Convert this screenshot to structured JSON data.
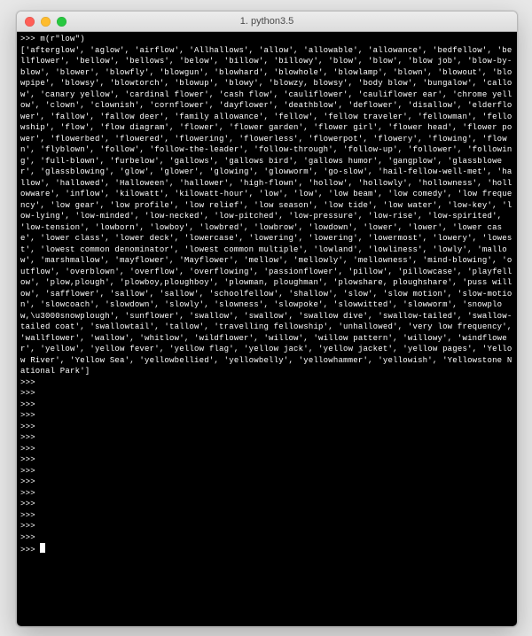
{
  "window": {
    "title": "1. python3.5"
  },
  "terminal": {
    "prompt": ">>> ",
    "input_line": "m(r\"low\")",
    "output_list": [
      "afterglow",
      "aglow",
      "airflow",
      "Allhallows",
      "allow",
      "allowable",
      "allowance",
      "bedfellow",
      "bellflower",
      "bellow",
      "bellows",
      "below",
      "billow",
      "billowy",
      "blow",
      "blow",
      "blow job",
      "blow-by-blow",
      "blower",
      "blowfly",
      "blowgun",
      "blowhard",
      "blowhole",
      "blowlamp",
      "blown",
      "blowout",
      "blowpipe",
      "blowsy",
      "blowtorch",
      "blowup",
      "blowy",
      "blowzy, blowsy",
      "body blow",
      "bungalow",
      "callow",
      "canary yellow",
      "cardinal flower",
      "cash flow",
      "cauliflower",
      "cauliflower ear",
      "chrome yellow",
      "clown",
      "clownish",
      "cornflower",
      "dayflower",
      "deathblow",
      "deflower",
      "disallow",
      "elderflower",
      "fallow",
      "fallow deer",
      "family allowance",
      "fellow",
      "fellow traveler",
      "fellowman",
      "fellowship",
      "flow",
      "flow diagram",
      "flower",
      "flower garden",
      "flower girl",
      "flower head",
      "flower power",
      "flowerbed",
      "flowered",
      "flowering",
      "flowerless",
      "flowerpot",
      "flowery",
      "flowing",
      "flown",
      "flyblown",
      "follow",
      "follow-the-leader",
      "follow-through",
      "follow-up",
      "follower",
      "following",
      "full-blown",
      "furbelow",
      "gallows",
      "gallows bird",
      "gallows humor",
      "gangplow",
      "glassblower",
      "glassblowing",
      "glow",
      "glower",
      "glowing",
      "glowworm",
      "go-slow",
      "hail-fellow-well-met",
      "hallow",
      "hallowed",
      "Halloween",
      "hallower",
      "high-flown",
      "hollow",
      "hollowly",
      "hollowness",
      "hollowware",
      "inflow",
      "kilowatt",
      "kilowatt-hour",
      "low",
      "low",
      "low beam",
      "low comedy",
      "low frequency",
      "low gear",
      "low profile",
      "low relief",
      "low season",
      "low tide",
      "low water",
      "low-key",
      "low-lying",
      "low-minded",
      "low-necked",
      "low-pitched",
      "low-pressure",
      "low-rise",
      "low-spirited",
      "low-tension",
      "lowborn",
      "lowboy",
      "lowbred",
      "lowbrow",
      "lowdown",
      "lower",
      "lower",
      "lower case",
      "lower class",
      "lower deck",
      "lowercase",
      "lowering",
      "lowering",
      "lowermost",
      "lowery",
      "lowest",
      "lowest common denominator",
      "lowest common multiple",
      "lowland",
      "lowliness",
      "lowly",
      "mallow",
      "marshmallow",
      "mayflower",
      "Mayflower",
      "mellow",
      "mellowly",
      "mellowness",
      "mind-blowing",
      "outflow",
      "overblown",
      "overflow",
      "overflowing",
      "passionflower",
      "pillow",
      "pillowcase",
      "playfellow",
      "plow,plough",
      "plowboy,ploughboy",
      "plowman, ploughman",
      "plowshare, ploughshare",
      "puss willow",
      "safflower",
      "sallow",
      "sallow",
      "schoolfellow",
      "shallow",
      "slow",
      "slow motion",
      "slow-motion",
      "slowcoach",
      "slowdown",
      "slowly",
      "slowness",
      "slowpoke",
      "slowwitted",
      "slowworm",
      "snowplow,\\u3000snowplough",
      "sunflower",
      "swallow",
      "swallow",
      "swallow dive",
      "swallow-tailed",
      "swallow-tailed coat",
      "swallowtail",
      "tallow",
      "travelling fellowship",
      "unhallowed",
      "very low frequency",
      "wallflower",
      "wallow",
      "whitlow",
      "wildflower",
      "willow",
      "willow pattern",
      "willowy",
      "windflower",
      "yellow",
      "yellow fever",
      "yellow flag",
      "yellow jack",
      "yellow jacket",
      "yellow pages",
      "Yellow River",
      "Yellow Sea",
      "yellowbellied",
      "yellowbelly",
      "yellowhammer",
      "yellowish",
      "Yellowstone National Park"
    ],
    "empty_prompts": 15
  }
}
